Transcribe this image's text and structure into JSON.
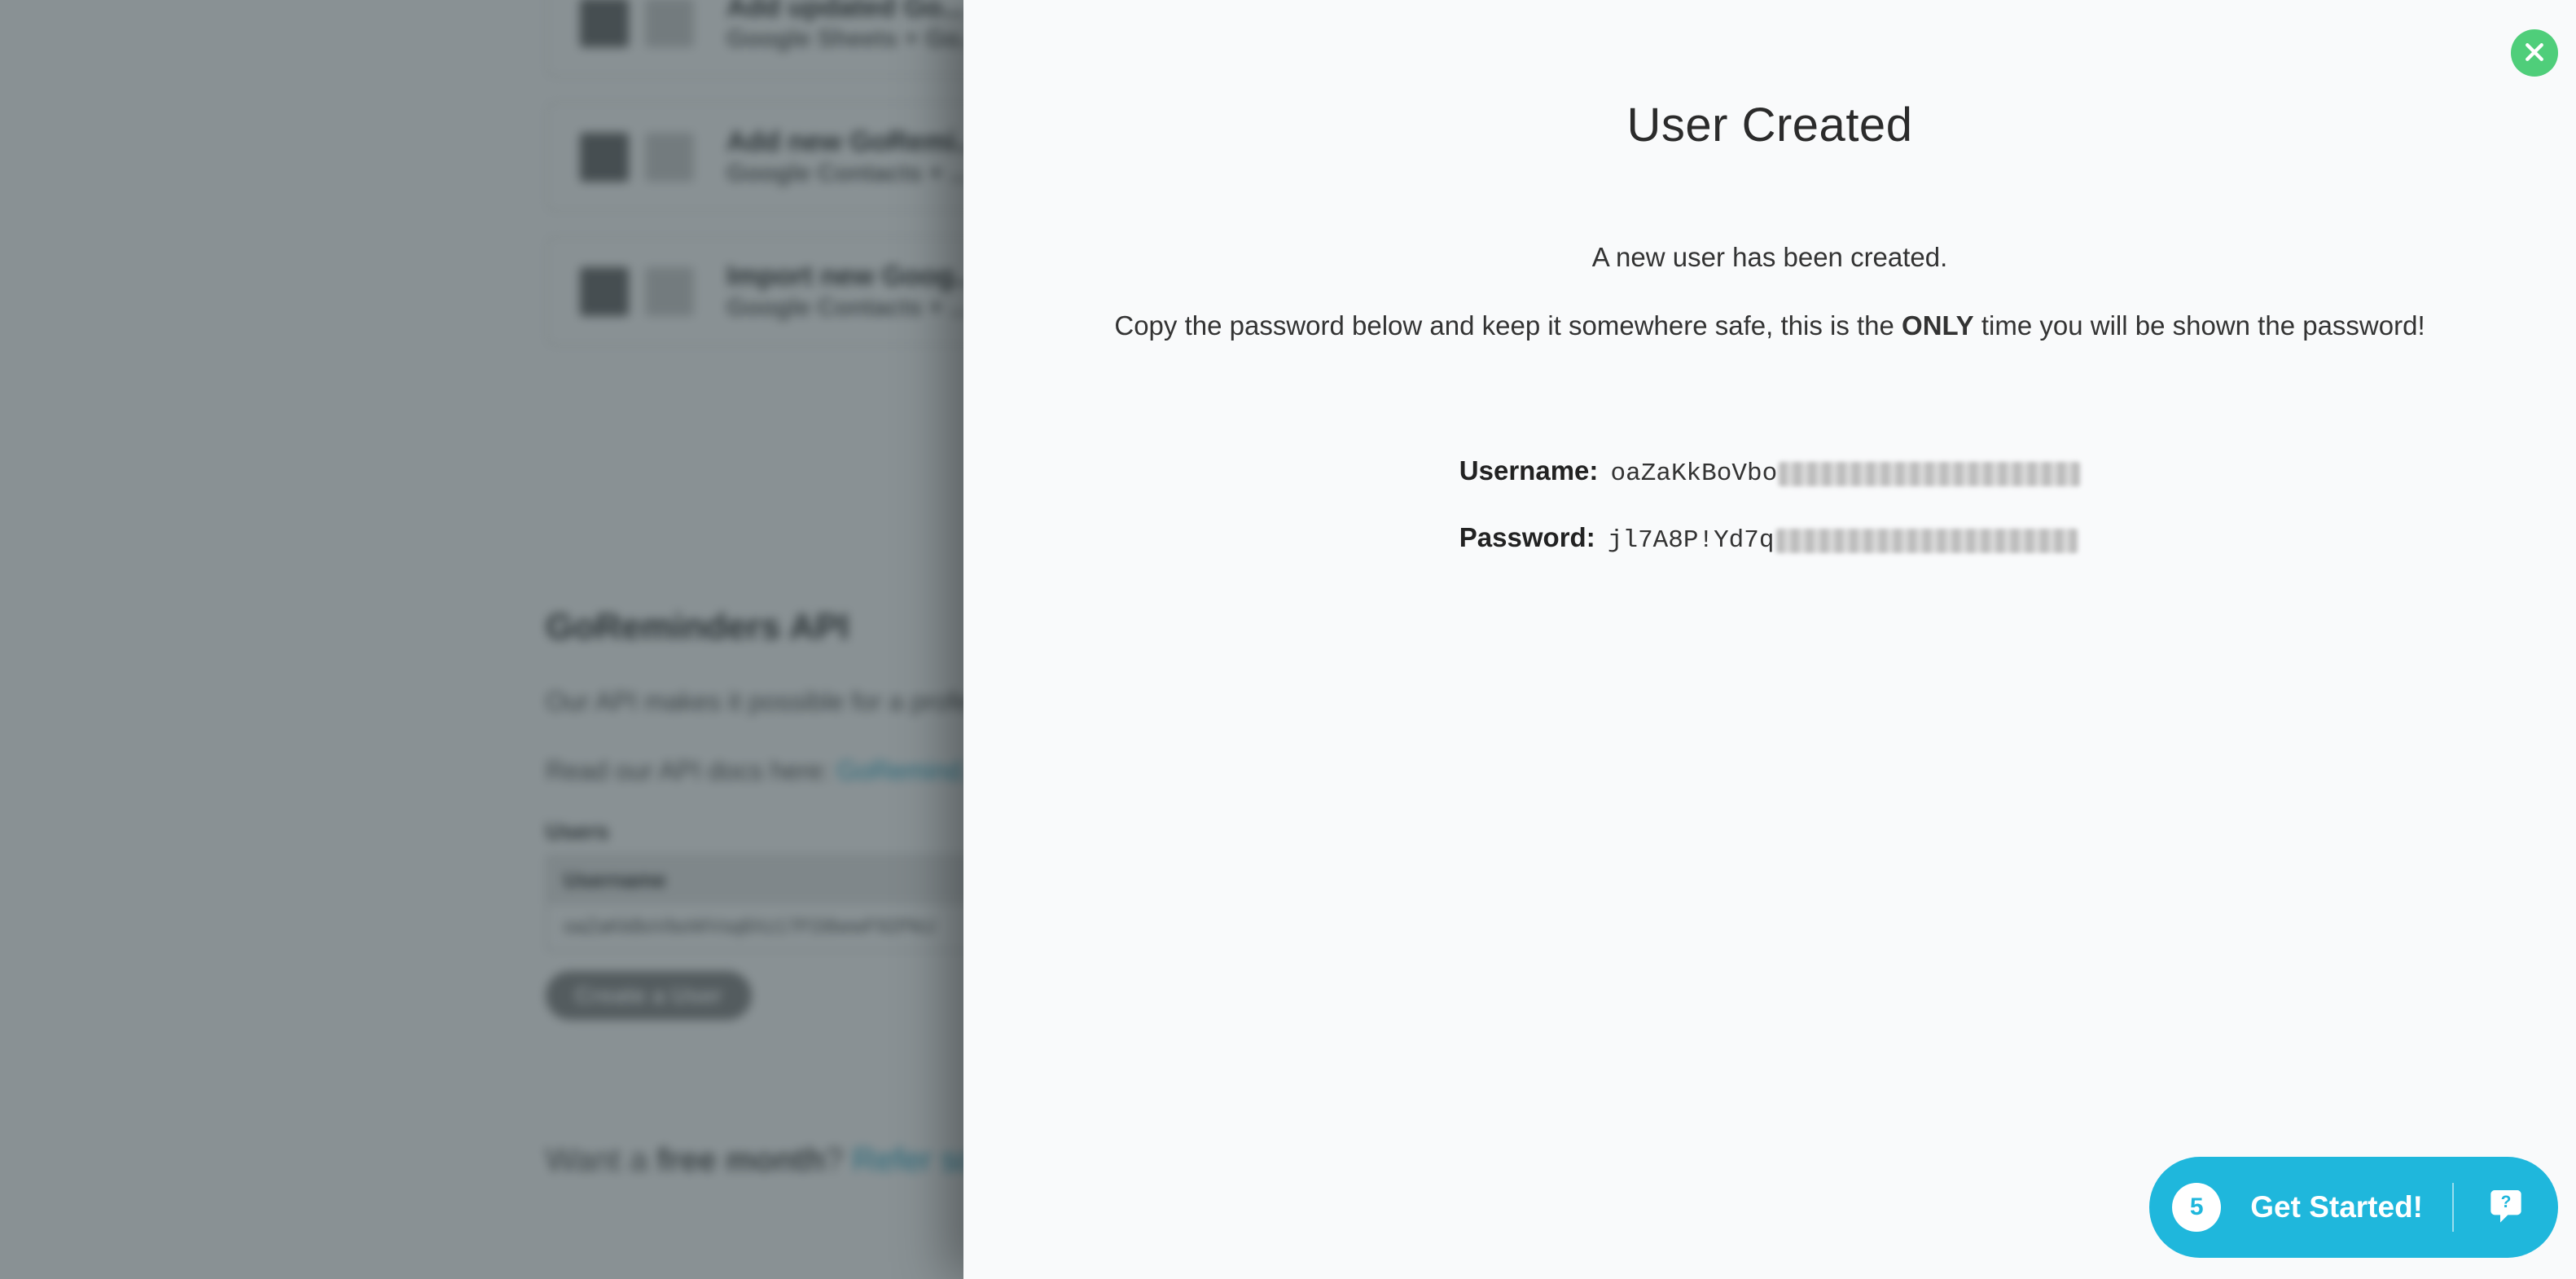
{
  "background": {
    "zapCards": [
      {
        "title": "Add updated Go...",
        "subtitle": "Google Sheets + Go..."
      },
      {
        "title": "Add new GoRemi...",
        "subtitle": "Google Contacts + ..."
      },
      {
        "title": "Import new Goog...",
        "subtitle": "Google Contacts + ..."
      }
    ],
    "api": {
      "heading": "GoReminders API",
      "description": "Our API makes it possible for a profe...",
      "docsPrefix": "Read our API docs here: ",
      "docsLinkText": "GoRemind..."
    },
    "usersSection": {
      "label": "Users",
      "columnHeader": "Username",
      "rowValue": "oaZaKkBoVboWVsq8Xz17P2i8wwF92PkU",
      "createButton": "Create a User"
    },
    "refer": {
      "prefix": "Want a ",
      "bold": "free month",
      "q": "? ",
      "linkText": "Refer some..."
    }
  },
  "panel": {
    "title": "User Created",
    "line1": "A new user has been created.",
    "line2_pre": "Copy the password below and keep it somewhere safe, this is the ",
    "line2_bold": "ONLY",
    "line2_post": " time you will be shown the password!",
    "username_label": "Username:",
    "username_value_visible": "oaZaKkBoVbo",
    "password_label": "Password:",
    "password_value_visible": "jl7A8P!Yd7q"
  },
  "getStarted": {
    "count": "5",
    "label": "Get Started!"
  }
}
